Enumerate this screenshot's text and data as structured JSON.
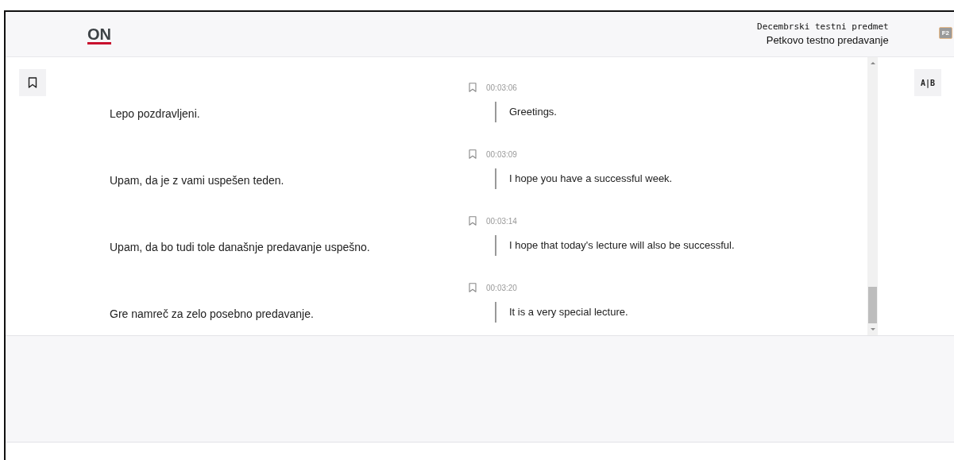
{
  "header": {
    "logo": "ON",
    "course": "Decembrski testni predmet",
    "lecture": "Petkovo testno predavanje",
    "shortcut_badge": "F2"
  },
  "toggle_button": "A|B",
  "segments": [
    {
      "source": "Lepo pozdravljeni.",
      "time": "00:03:06",
      "translation": "Greetings."
    },
    {
      "source": "Upam, da je z vami uspešen teden.",
      "time": "00:03:09",
      "translation": "I hope you have a successful week."
    },
    {
      "source": "Upam, da bo tudi tole današnje predavanje uspešno.",
      "time": "00:03:14",
      "translation": "I hope that today's lecture will also be successful."
    },
    {
      "source": "Gre namreč za zelo posebno predavanje.",
      "time": "00:03:20",
      "translation": "It is a very special lecture."
    }
  ]
}
